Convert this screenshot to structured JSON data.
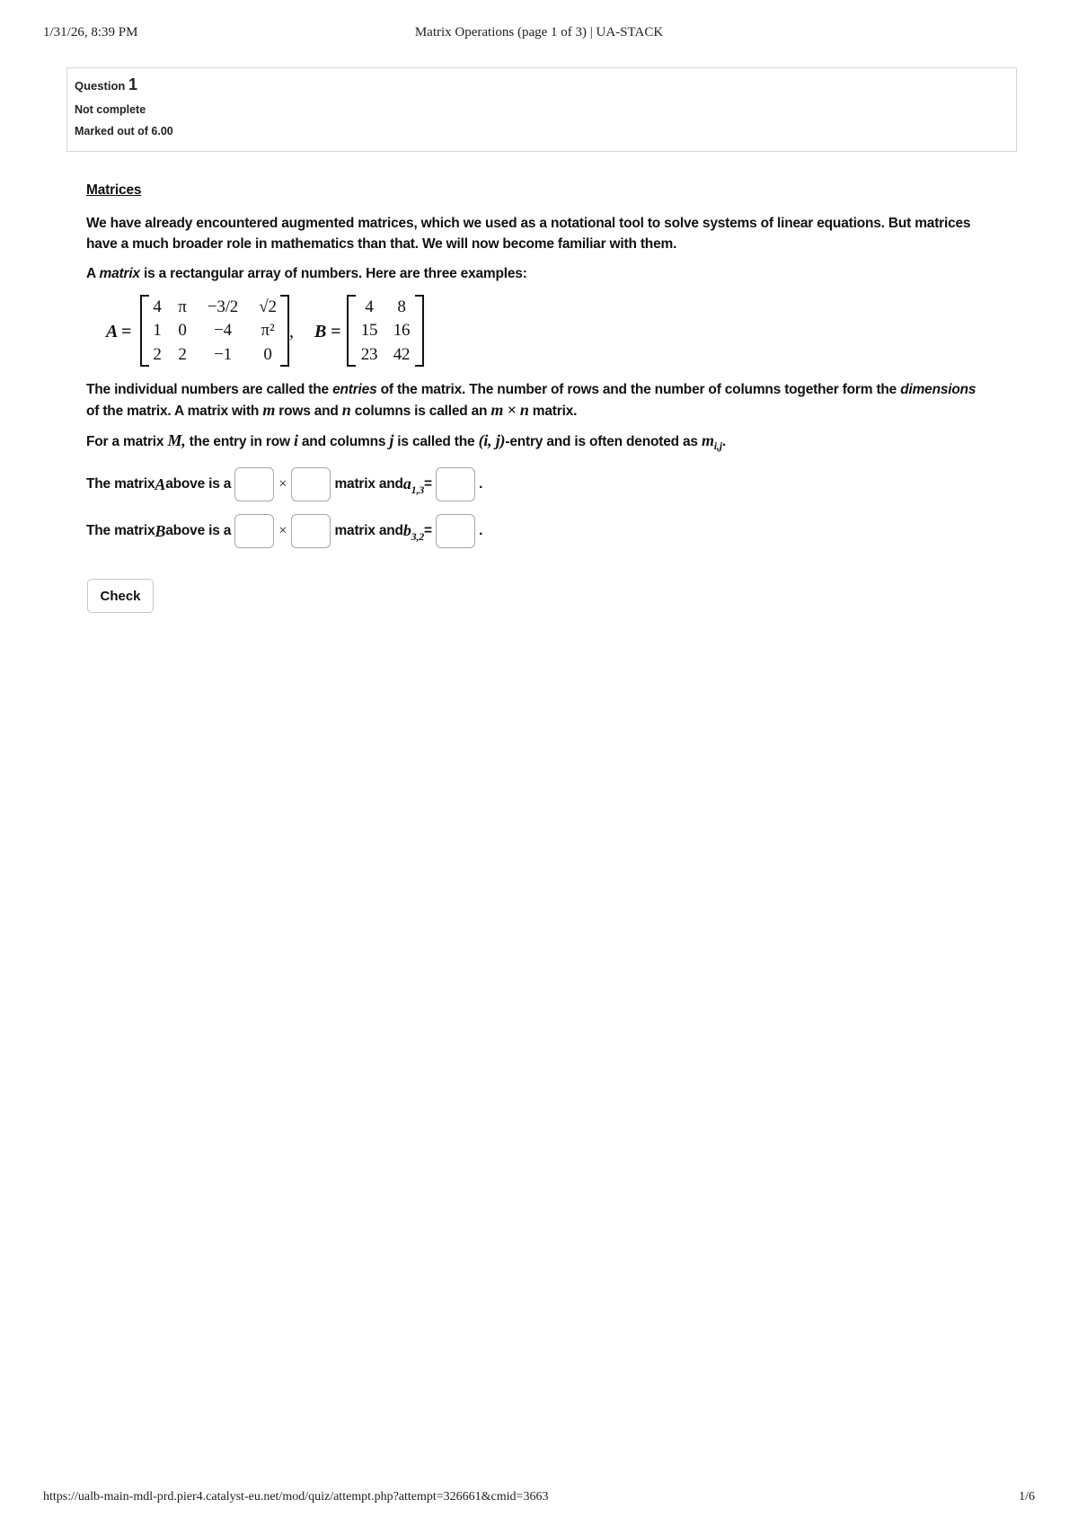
{
  "print_header": {
    "date": "1/31/26, 8:39 PM",
    "title": "Matrix Operations (page 1 of 3) | UA-STACK"
  },
  "question_info": {
    "label": "Question",
    "number": "1",
    "state": "Not complete",
    "marks": "Marked out of 6.00"
  },
  "content": {
    "heading": "Matrices",
    "intro": "We have already encountered augmented matrices, which we used as a notational tool to solve systems of linear equations. But matrices have a much broader role in mathematics than that. We will now become familiar with them.",
    "definition_pre": "A ",
    "definition_em": "matrix",
    "definition_post": " is a rectangular array of numbers. Here are three examples:",
    "matrix_a": {
      "label": "A =",
      "rows": [
        [
          "4",
          "π",
          "−3/2",
          "√2"
        ],
        [
          "1",
          "0",
          "−4",
          "π²"
        ],
        [
          "2",
          "2",
          "−1",
          "0"
        ]
      ]
    },
    "matrix_separator": ",",
    "matrix_b": {
      "label": "B =",
      "rows": [
        [
          "4",
          "8"
        ],
        [
          "15",
          "16"
        ],
        [
          "23",
          "42"
        ]
      ]
    },
    "entries_text_1": "The individual numbers are called the ",
    "entries_em": "entries",
    "entries_text_2": " of the matrix. The number of rows and the number of columns together form the ",
    "dimensions_em": "dimensions",
    "entries_text_3": " of the matrix. A matrix with ",
    "m": "m",
    "entries_text_4": " rows and ",
    "n": "n",
    "entries_text_5": " columns is called an ",
    "m_times_n": "m × n",
    "entries_text_6": " matrix.",
    "entry_text_1": "For a matrix ",
    "M": "M,",
    "entry_text_2": " the entry in row ",
    "i": "i",
    "entry_text_3": " and columns ",
    "j": "j",
    "entry_text_4": " is called the ",
    "ij": "(i, j)",
    "entry_text_5": "-entry and is often denoted as ",
    "mij": "m",
    "mij_sub": "i,j",
    "entry_text_6": "."
  },
  "fill_rows": [
    {
      "prefix_1": "The matrix ",
      "var": "A",
      "prefix_2": " above is a ",
      "times": "×",
      "middle": " matrix and ",
      "entry": "a",
      "entry_sub": "1,3",
      "equals": " =",
      "suffix": "."
    },
    {
      "prefix_1": "The matrix ",
      "var": "B",
      "prefix_2": " above is a ",
      "times": "×",
      "middle": " matrix and ",
      "entry": "b",
      "entry_sub": "3,2",
      "equals": " =",
      "suffix": "."
    }
  ],
  "check_label": "Check",
  "print_footer": {
    "url": "https://ualb-main-mdl-prd.pier4.catalyst-eu.net/mod/quiz/attempt.php?attempt=326661&cmid=3663",
    "page": "1/6"
  }
}
